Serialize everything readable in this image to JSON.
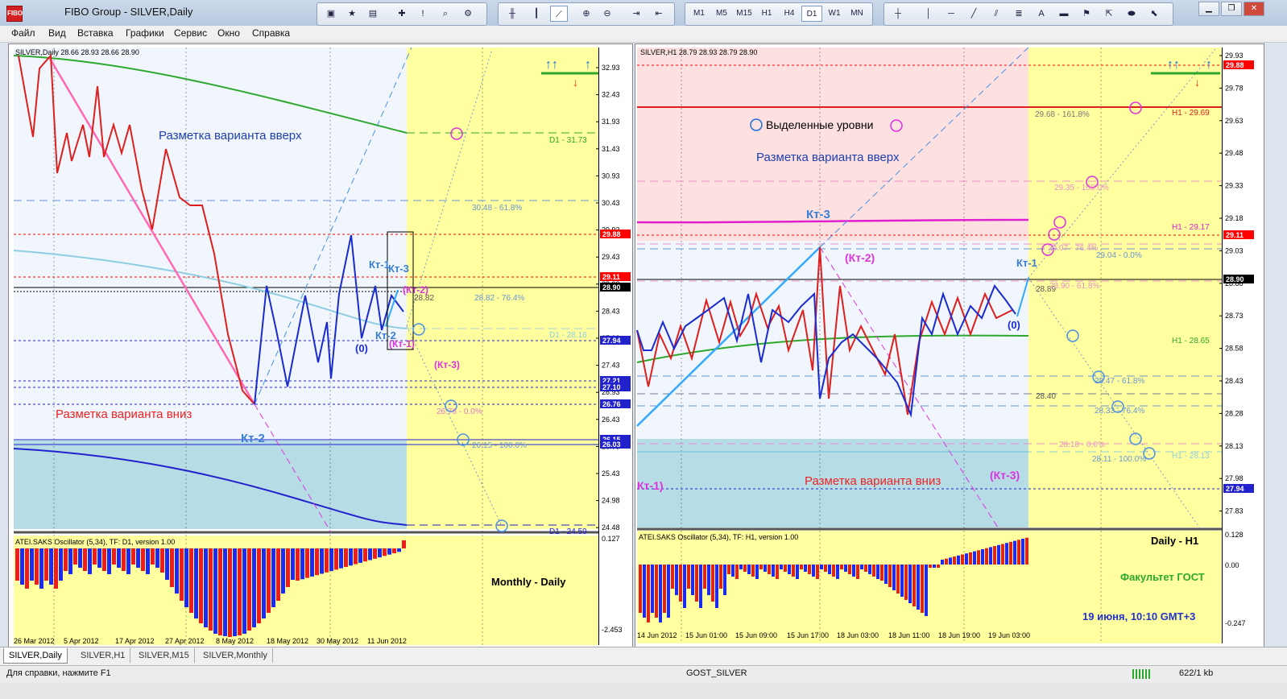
{
  "window": {
    "title": "FIBO Group - SILVER,Daily",
    "logo_text": "FIBO"
  },
  "menu": [
    "Файл",
    "Вид",
    "Вставка",
    "Графики",
    "Сервис",
    "Окно",
    "Справка"
  ],
  "toolbar": {
    "timeframes": [
      "M1",
      "M5",
      "M15",
      "H1",
      "H4",
      "D1",
      "W1",
      "MN"
    ],
    "active_timeframe": "D1"
  },
  "left_chart": {
    "header": "SILVER,Daily  28.66 28.93 28.66 28.90",
    "price_axis": [
      "32.93",
      "32.43",
      "31.93",
      "31.43",
      "30.93",
      "30.43",
      "29.93",
      "29.43",
      "28.93",
      "28.43",
      "27.93",
      "27.43",
      "26.93",
      "26.43",
      "25.93",
      "25.43",
      "24.98",
      "24.48"
    ],
    "price_tags": [
      {
        "text": "29.88",
        "color": "#ff0000"
      },
      {
        "text": "29.11",
        "color": "#ff0000"
      },
      {
        "text": "28.90",
        "color": "#000000"
      },
      {
        "text": "27.94",
        "color": "#2222cc"
      },
      {
        "text": "27.21",
        "color": "#2222cc"
      },
      {
        "text": "27.10",
        "color": "#2222cc"
      },
      {
        "text": "26.76",
        "color": "#2222cc"
      },
      {
        "text": "26.15",
        "color": "#2222cc"
      },
      {
        "text": "26.03",
        "color": "#2222cc"
      }
    ],
    "dates": [
      "26 Mar 2012",
      "5 Apr 2012",
      "17 Apr 2012",
      "27 Apr 2012",
      "8 May 2012",
      "18 May 2012",
      "30 May 2012",
      "11 Jun 2012"
    ],
    "labels": {
      "up_markup": "Разметка варианта вверх",
      "down_markup": "Разметка варианта вниз",
      "kt1": "Кт-1",
      "kt2": "Кт-2",
      "kt3": "Кт-3",
      "kt2_big": "Кт-2",
      "kt2_paren": "(Кт-2)",
      "kt1_paren": "(Кт-1)",
      "kt3_paren": "(Кт-3)",
      "zero": "(0)",
      "lvl_2882": "28.82",
      "fib_3048": "30.48 - 61.8%",
      "fib_2882": "28.82 - 76.4%",
      "fib_2676": "26.76 - 0.0%",
      "fib_2615": "26.15 - 100.0%",
      "d1_3173": "D1 - 31.73",
      "d1_2816": "D1 - 28.16",
      "d1_2459": "D1 - 24.59"
    },
    "osc_header": "ATEI.SAKS Oscillator (5,34), TF: D1, version 1.00",
    "osc_axis": [
      "0.127",
      "-2.453"
    ],
    "osc_label": "Monthly - Daily"
  },
  "right_chart": {
    "header": "SILVER,H1  28.79 28.93 28.79 28.90",
    "price_axis": [
      "29.93",
      "29.78",
      "29.63",
      "29.48",
      "29.33",
      "29.18",
      "29.03",
      "28.88",
      "28.73",
      "28.58",
      "28.43",
      "28.28",
      "28.13",
      "27.98",
      "27.83"
    ],
    "price_tags": [
      {
        "text": "29.88",
        "color": "#ff0000"
      },
      {
        "text": "29.11",
        "color": "#ff0000"
      },
      {
        "text": "28.90",
        "color": "#000000"
      },
      {
        "text": "27.94",
        "color": "#2222cc"
      }
    ],
    "dates": [
      "14 Jun 2012",
      "15 Jun 01:00",
      "15 Jun 09:00",
      "15 Jun 17:00",
      "18 Jun 03:00",
      "18 Jun 11:00",
      "18 Jun 19:00",
      "19 Jun 03:00"
    ],
    "labels": {
      "levels_legend": "Выделенные уровни",
      "up_markup": "Разметка варианта вверх",
      "down_markup": "Разметка варианта вниз",
      "kt3": "Кт-3",
      "kt2_paren": "(Кт-2)",
      "kt1": "Кт-1",
      "kt1_paren": "Кт-1)",
      "kt3_paren": "(Кт-3)",
      "zero": "(0)",
      "lvl_2889": "28.89",
      "lvl_2840": "28.40",
      "fib_2968": "29.68 - 161.8%",
      "fib_2935": "29.35 - 100.0%",
      "fib_2907": "29.07 - 76.4%",
      "fib_2904": "29.04 - 0.0%",
      "fib_2890": "28.90 - 61.8%",
      "fib_2847": "28.47 - 61.8%",
      "fib_2833": "28.33 - 76.4%",
      "fib_2818": "28.18 - 0.0%",
      "fib_2811": "28.11 - 100.0%",
      "h1_2969": "H1 - 29.69",
      "h1_2917": "H1 - 29.17",
      "h1_2865": "H1 - 28.65",
      "h1_2813": "H1 - 28.13"
    },
    "osc_header": "ATEI.SAKS Oscillator (5,34), TF: H1, version 1.00",
    "osc_axis": [
      "0.128",
      "0.00",
      "-0.247"
    ],
    "osc_labels": {
      "tf": "Daily - H1",
      "faculty": "Факультет ГОСТ",
      "datetime": "19 июня, 10:10  GMT+3"
    }
  },
  "tabs": [
    "SILVER,Daily",
    "SILVER,H1",
    "SILVER,M15",
    "SILVER,Monthly"
  ],
  "active_tab": 0,
  "status": {
    "help": "Для справки, нажмите F1",
    "profile": "GOST_SILVER",
    "traffic": "622/1 kb"
  }
}
